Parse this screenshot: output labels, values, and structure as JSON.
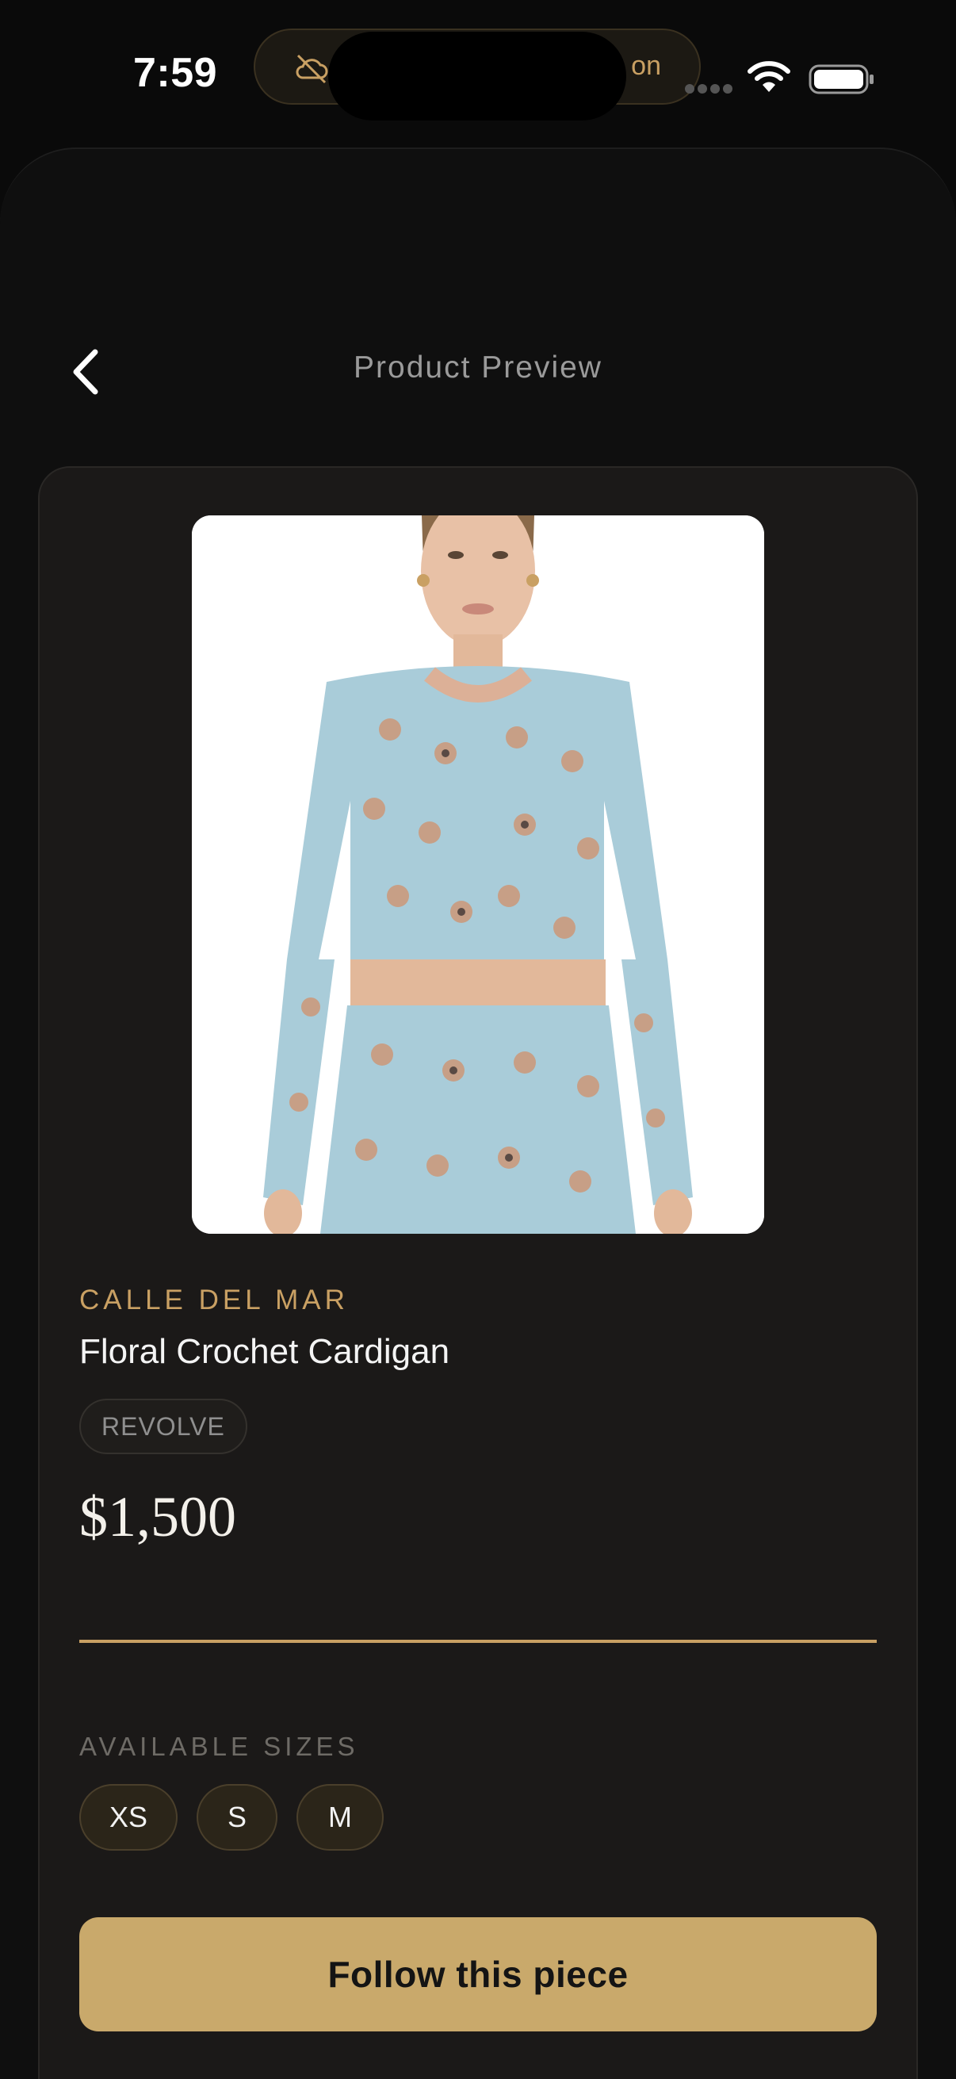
{
  "status_bar": {
    "time": "7:59",
    "pill_text": "on",
    "pill_icon": "cloud-off-icon"
  },
  "nav": {
    "back_icon": "chevron-left-icon",
    "title": "Product Preview"
  },
  "product": {
    "image_description_icon": "product-photo",
    "brand": "CALLE DEL MAR",
    "name": "Floral Crochet Cardigan",
    "retailer": "REVOLVE",
    "price": "$1,500"
  },
  "sizes": {
    "label": "AVAILABLE SIZES",
    "options": [
      "XS",
      "S",
      "M"
    ]
  },
  "actions": {
    "follow_label": "Follow this piece"
  },
  "colors": {
    "accent": "#c9a063",
    "button": "#c9a96b",
    "background": "#0f0f0f",
    "card": "#1b1918"
  }
}
